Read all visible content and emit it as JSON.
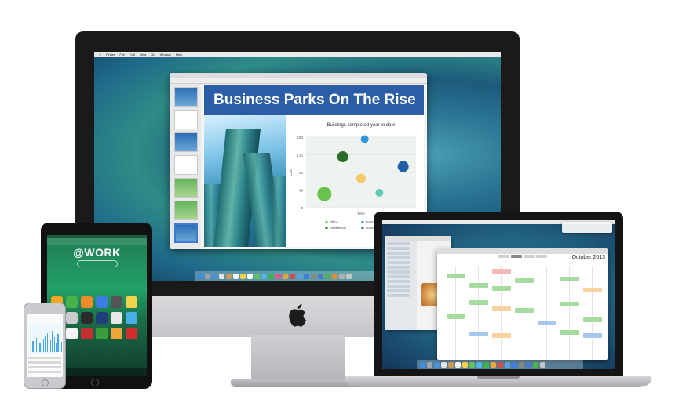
{
  "imac": {
    "menubar": {
      "items": [
        "Finder",
        "File",
        "Edit",
        "View",
        "Go",
        "Window",
        "Help"
      ]
    },
    "keynote": {
      "slide_title": "Business Parks On The Rise",
      "chart_data": {
        "type": "scatter",
        "title": "Buildings completed year to date",
        "xlabel": "Time",
        "ylabel": "Cost",
        "y_ticks": [
          "180",
          "135",
          "90",
          "45",
          "0"
        ],
        "ylim": [
          0,
          180
        ],
        "grid": true,
        "legend_position": "bottom",
        "legend": [
          "Office",
          "Business Parks",
          "Residential",
          "Government"
        ],
        "points": [
          {
            "x": 1,
            "y": 35,
            "r": 9,
            "color": "#69c24f"
          },
          {
            "x": 2,
            "y": 130,
            "r": 7,
            "color": "#2a6e2a"
          },
          {
            "x": 3,
            "y": 75,
            "r": 6,
            "color": "#f5c86a"
          },
          {
            "x": 3.2,
            "y": 175,
            "r": 5,
            "color": "#2f96dc"
          },
          {
            "x": 4,
            "y": 38,
            "r": 5,
            "color": "#5fcab7"
          },
          {
            "x": 5.3,
            "y": 105,
            "r": 7,
            "color": "#1f5fa8"
          }
        ],
        "xlim": [
          0,
          6
        ]
      }
    }
  },
  "macbook": {
    "calendar": {
      "month": "October 2013"
    }
  },
  "ipad": {
    "headline": "@WORK"
  },
  "colors": {
    "slide_header": "#2b5ea7",
    "ipad_green": "#23a069"
  }
}
